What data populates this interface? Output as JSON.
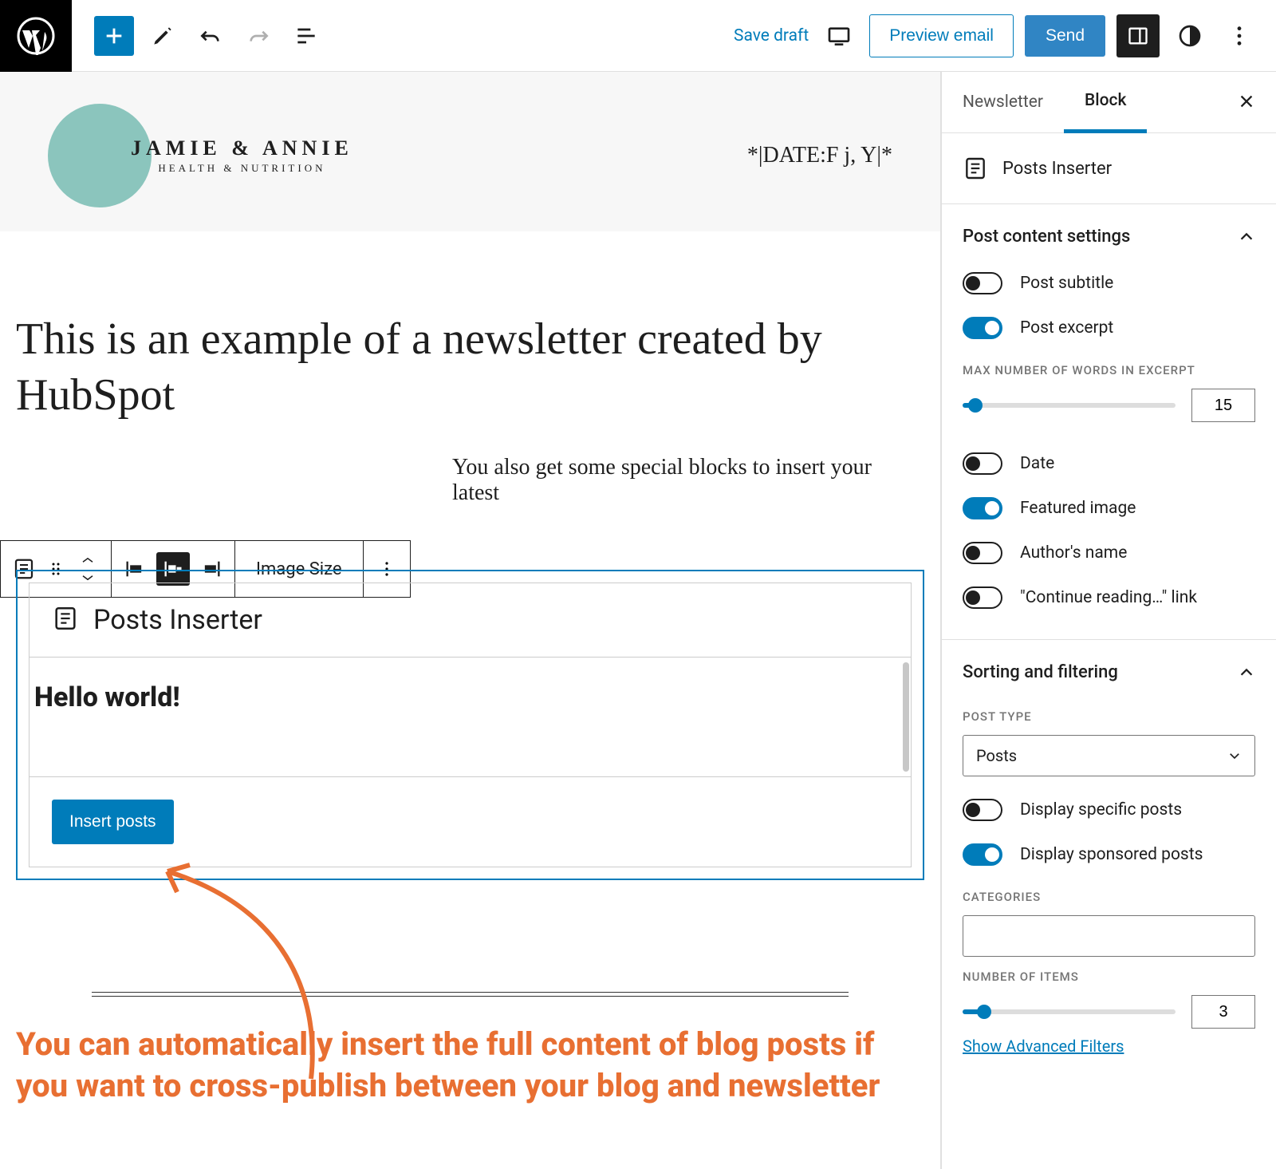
{
  "topbar": {
    "save_draft": "Save draft",
    "preview": "Preview email",
    "send": "Send"
  },
  "editor": {
    "brand_main": "JAMIE & ANNIE",
    "brand_sub": "HEALTH & NUTRITION",
    "date_token": "*|DATE:F j, Y|*",
    "title": "This is an example of a newsletter created by HubSpot",
    "para_fragment": "You also get some special blocks to insert your latest",
    "image_size_label": "Image Size",
    "pi_block_name": "Posts Inserter",
    "pi_preview_title": "Hello world!",
    "insert_posts": "Insert posts",
    "annotation": "You can automatically insert the full content of blog posts if you want to cross-publish between your blog and newsletter"
  },
  "sidebar": {
    "tab_newsletter": "Newsletter",
    "tab_block": "Block",
    "block_name": "Posts Inserter",
    "panel_content": "Post content settings",
    "toggle_subtitle": "Post subtitle",
    "toggle_excerpt": "Post excerpt",
    "max_words_label": "MAX NUMBER OF WORDS IN EXCERPT",
    "max_words_value": "15",
    "toggle_date": "Date",
    "toggle_featured": "Featured image",
    "toggle_author": "Author's name",
    "toggle_continue": "\"Continue reading…\" link",
    "panel_sorting": "Sorting and filtering",
    "post_type_label": "POST TYPE",
    "post_type_value": "Posts",
    "toggle_specific": "Display specific posts",
    "toggle_sponsored": "Display sponsored posts",
    "categories_label": "CATEGORIES",
    "num_items_label": "NUMBER OF ITEMS",
    "num_items_value": "3",
    "adv_filters": "Show Advanced Filters",
    "toggles": {
      "subtitle": false,
      "excerpt": true,
      "date": false,
      "featured": true,
      "author": false,
      "continue": false,
      "specific": false,
      "sponsored": true
    }
  }
}
